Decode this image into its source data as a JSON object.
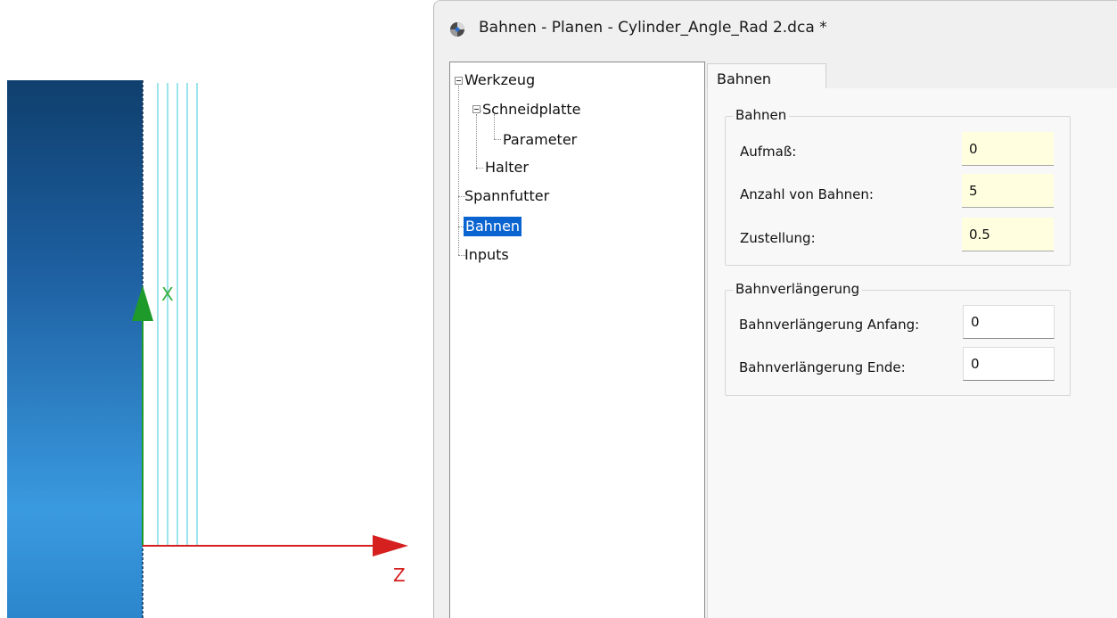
{
  "viewport": {
    "axis_x_label": "X",
    "axis_z_label": "Z",
    "colors": {
      "x_axis": "#1e9a2a",
      "z_axis": "#d62020",
      "part_top": "#0f3f6d",
      "part_bottom": "#3a9ae0",
      "toolpath": "#39c8d8"
    },
    "toolpath_count": 5
  },
  "dialog": {
    "title": "Bahnen - Planen - Cylinder_Angle_Rad 2.dca *",
    "app_icon": "app-logo-icon"
  },
  "tree": {
    "items": [
      {
        "label": "Werkzeug",
        "expanded": true
      },
      {
        "label": "Schneidplatte",
        "expanded": true
      },
      {
        "label": "Parameter"
      },
      {
        "label": "Halter"
      },
      {
        "label": "Spannfutter"
      },
      {
        "label": "Bahnen",
        "selected": true
      },
      {
        "label": "Inputs"
      }
    ]
  },
  "tabs": [
    {
      "label": "Bahnen",
      "active": true
    }
  ],
  "group_bahnen": {
    "title": "Bahnen",
    "fields": [
      {
        "label": "Aufmaß:",
        "value": "0"
      },
      {
        "label": "Anzahl von Bahnen:",
        "value": "5"
      },
      {
        "label": "Zustellung:",
        "value": "0.5"
      }
    ]
  },
  "group_bahnverlaengerung": {
    "title": "Bahnverlängerung",
    "fields": [
      {
        "label": "Bahnverlängerung Anfang:",
        "value": "0"
      },
      {
        "label": "Bahnverlängerung Ende:",
        "value": "0"
      }
    ]
  }
}
